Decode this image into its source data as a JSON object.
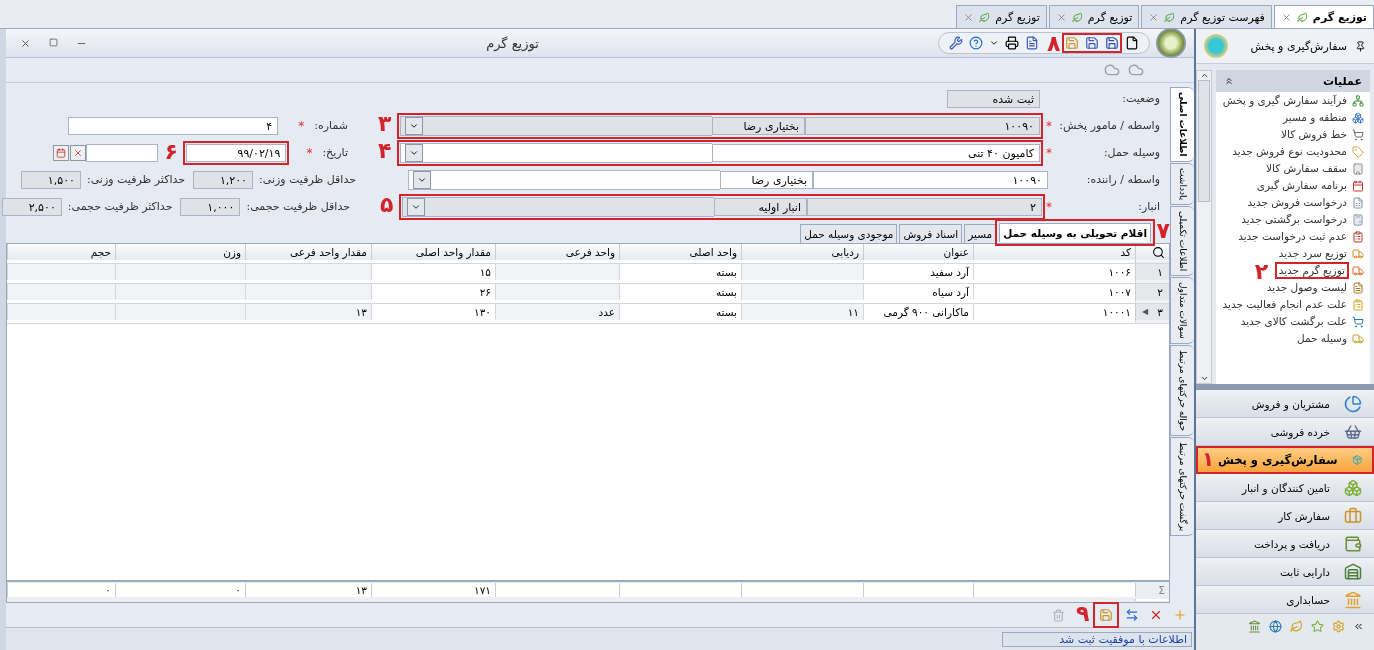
{
  "doc_tabs": [
    {
      "label": "توزیع گرم",
      "selected": true
    },
    {
      "label": "فهرست توزیع گرم",
      "selected": false
    },
    {
      "label": "توزیع گرم",
      "selected": false
    },
    {
      "label": "توزیع گرم",
      "selected": false
    }
  ],
  "window": {
    "title": "توزیع گرم",
    "toolbar_callout": "۸"
  },
  "form": {
    "status": {
      "label": "وضعیت:",
      "value": "ثبت شده"
    },
    "rows": [
      {
        "label": "واسطه / مامور پخش:",
        "mark": "*",
        "code": "۱۰۰۹۰",
        "name": "بختیاری رضا",
        "disabled": true,
        "callout": "۳",
        "side": [
          {
            "label": "شماره:",
            "mark": "*",
            "value": "۴",
            "kind": "wide"
          }
        ]
      },
      {
        "label": "وسیله حمل:",
        "mark": "*",
        "code": "کامیون ۴۰ تنی",
        "disabled": false,
        "callout": "۴",
        "side": [
          {
            "label": "تاریخ:",
            "mark": "*",
            "value": "۹۹/۰۲/۱۹",
            "kind": "date",
            "callout": "۶"
          }
        ]
      },
      {
        "label": "واسطه / راننده:",
        "code": "۱۰۰۹۰",
        "name": "بختیاری رضا",
        "disabled": false,
        "side": [
          {
            "label": "حداقل ظرفیت وزنی:",
            "value": "۱,۲۰۰",
            "kind": "small"
          },
          {
            "label": "حداکثر ظرفیت وزنی:",
            "value": "۱,۵۰۰",
            "kind": "small"
          }
        ]
      },
      {
        "label": "انبار:",
        "mark": "*",
        "code": "۲",
        "name": "انبار اولیه",
        "disabled": true,
        "callout": "۵",
        "side": [
          {
            "label": "حداقل ظرفیت حجمی:",
            "value": "۱,۰۰۰",
            "kind": "small"
          },
          {
            "label": "حداکثر ظرفیت حجمی:",
            "value": "۲,۵۰۰",
            "kind": "small"
          }
        ]
      }
    ]
  },
  "side_tabs": [
    {
      "label": "اطلاعات اصلی",
      "selected": true
    },
    {
      "label": "یادداشت",
      "selected": false
    },
    {
      "label": "اطلاعات تکمیلی",
      "selected": false
    },
    {
      "label": "سوالات متداول",
      "selected": false
    },
    {
      "label": "حواله حرکتهای مرتبط",
      "selected": false
    },
    {
      "label": "برگشت حرکتهای مرتبط",
      "selected": false
    }
  ],
  "inner_tabs": [
    {
      "label": "اقلام تحویلی به وسیله حمل",
      "selected": true,
      "callout": "۷"
    },
    {
      "label": "مسیر",
      "selected": false
    },
    {
      "label": "اسناد فروش",
      "selected": false
    },
    {
      "label": "موجودی وسیله حمل",
      "selected": false
    }
  ],
  "table": {
    "columns": [
      "کد",
      "عنوان",
      "ردیابی",
      "واحد اصلی",
      "واحد فرعی",
      "مقدار واحد اصلی",
      "مقدار واحد فرعی",
      "وزن",
      "حجم"
    ],
    "rows": [
      {
        "number": "۱",
        "cells": [
          "۱۰۰۶",
          "آرد سفید",
          null,
          "بسته",
          null,
          "۱۵",
          null,
          null,
          null
        ]
      },
      {
        "number": "۲",
        "cells": [
          "۱۰۰۷",
          "آرد سیاه",
          null,
          "بسته",
          null,
          "۲۶",
          null,
          null,
          null
        ]
      },
      {
        "number": "۳",
        "marker": "◀",
        "cells": [
          "۱۰۰۰۱",
          "ماکارانی ۹۰۰ گرمی",
          "۱۱",
          "بسته",
          "عدد",
          "۱۳۰",
          "۱۳",
          null,
          null
        ]
      }
    ],
    "footer_sign": "Σ",
    "footer": [
      "۱۷۱",
      "۱۳",
      "۰",
      "۰"
    ]
  },
  "bottom_toolbar": {
    "save_callout": "۹"
  },
  "status_bar": "اطلاعات با موفقیت ثبت شد",
  "sidebar": {
    "title": "سفارش‌گیری و پخش",
    "panel_title": "عملیات",
    "items": [
      {
        "label": "فرآیند سفارش گیری و پخش"
      },
      {
        "label": "منطقه و مسیر"
      },
      {
        "label": "خط فروش کالا"
      },
      {
        "label": "محدودیت نوع فروش جدید"
      },
      {
        "label": "سقف سفارش کالا"
      },
      {
        "label": "برنامه سفارش گیری"
      },
      {
        "label": "درخواست فروش جدید"
      },
      {
        "label": "درخواست برگشتی جدید"
      },
      {
        "label": "عدم ثبت درخواست جدید"
      },
      {
        "label": "توزیع سرد جدید"
      },
      {
        "label": "توزیع گرم جدید",
        "callout": "۲"
      },
      {
        "label": "لیست وصول جدید"
      },
      {
        "label": "علت عدم انجام فعالیت جدید"
      },
      {
        "label": "علت برگشت کالای جدید"
      },
      {
        "label": "وسیله حمل"
      }
    ],
    "modules": [
      {
        "label": "مشتریان و فروش",
        "selected": false
      },
      {
        "label": "خرده فروشی",
        "selected": false
      },
      {
        "label": "سفارش‌گیری و پخش",
        "selected": true,
        "callout": "۱"
      },
      {
        "label": "تامین کنندگان و انبار",
        "selected": false
      },
      {
        "label": "سفارش کار",
        "selected": false
      },
      {
        "label": "دریافت و پرداخت",
        "selected": false
      },
      {
        "label": "دارایی ثابت",
        "selected": false
      },
      {
        "label": "حسابداری",
        "selected": false
      }
    ]
  }
}
